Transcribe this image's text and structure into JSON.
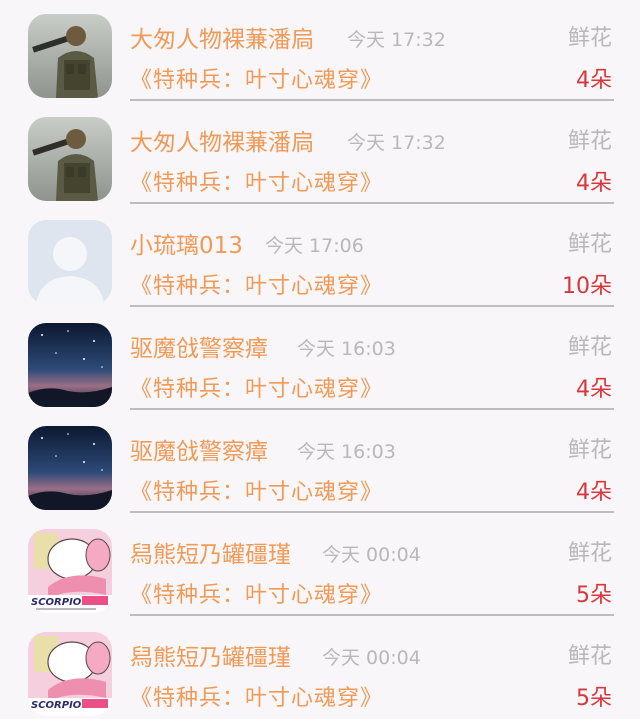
{
  "gift_label": "鲜花",
  "items": [
    {
      "name": "大匆人物裸蒹潘扃",
      "time": "今天 17:32",
      "book": "《特种兵：叶寸心魂穿》",
      "count": "4朵",
      "avatar": "soldier"
    },
    {
      "name": "大匆人物裸蒹潘扃",
      "time": "今天 17:32",
      "book": "《特种兵：叶寸心魂穿》",
      "count": "4朵",
      "avatar": "soldier"
    },
    {
      "name": "小琉璃013",
      "time": "今天 17:06",
      "book": "《特种兵：叶寸心魂穿》",
      "count": "10朵",
      "avatar": "default-user"
    },
    {
      "name": "驱魔戗警察瘴",
      "time": "今天 16:03",
      "book": "《特种兵：叶寸心魂穿》",
      "count": "4朵",
      "avatar": "night-sky"
    },
    {
      "name": "驱魔戗警察瘴",
      "time": "今天 16:03",
      "book": "《特种兵：叶寸心魂穿》",
      "count": "4朵",
      "avatar": "night-sky"
    },
    {
      "name": "舄熊短乃罐礓瑾",
      "time": "今天 00:04",
      "book": "《特种兵：叶寸心魂穿》",
      "count": "5朵",
      "avatar": "scorpio-cartoon"
    },
    {
      "name": "舄熊短乃罐礓瑾",
      "time": "今天 00:04",
      "book": "《特种兵：叶寸心魂穿》",
      "count": "5朵",
      "avatar": "scorpio-cartoon"
    }
  ],
  "avatar_text": {
    "scorpio": "SCORPIO"
  },
  "colors": {
    "name": "#ef9a57",
    "time": "#b8b8b8",
    "count": "#d9363c",
    "divider": "#bdbdbd",
    "background": "#f8f6f8"
  }
}
